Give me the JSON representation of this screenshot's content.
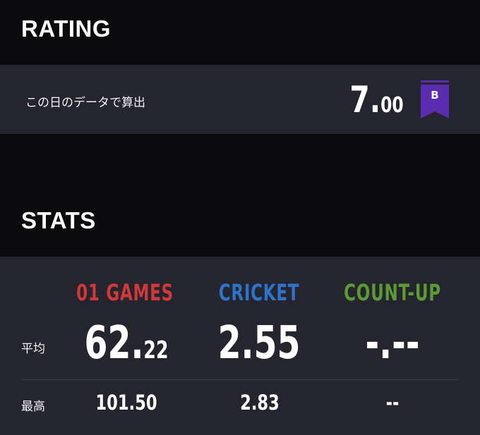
{
  "rating": {
    "title": "RATING",
    "label": "この日のデータで算出",
    "value_int": "7.",
    "value_dec": "00",
    "grade": "B",
    "grade_color": "#5b2cb0"
  },
  "stats": {
    "title": "STATS",
    "columns": [
      {
        "label": "01 GAMES",
        "color": "#d0393a"
      },
      {
        "label": "CRICKET",
        "color": "#2f73c9"
      },
      {
        "label": "COUNT-UP",
        "color": "#5b9a34"
      }
    ],
    "avg_label": "平均",
    "max_label": "最高",
    "avg": [
      {
        "big": "62.",
        "small": "22"
      },
      {
        "big": "2.55",
        "small": ""
      },
      {
        "big": "-.--",
        "small": ""
      }
    ],
    "max": [
      "101.50",
      "2.83",
      "--"
    ]
  }
}
